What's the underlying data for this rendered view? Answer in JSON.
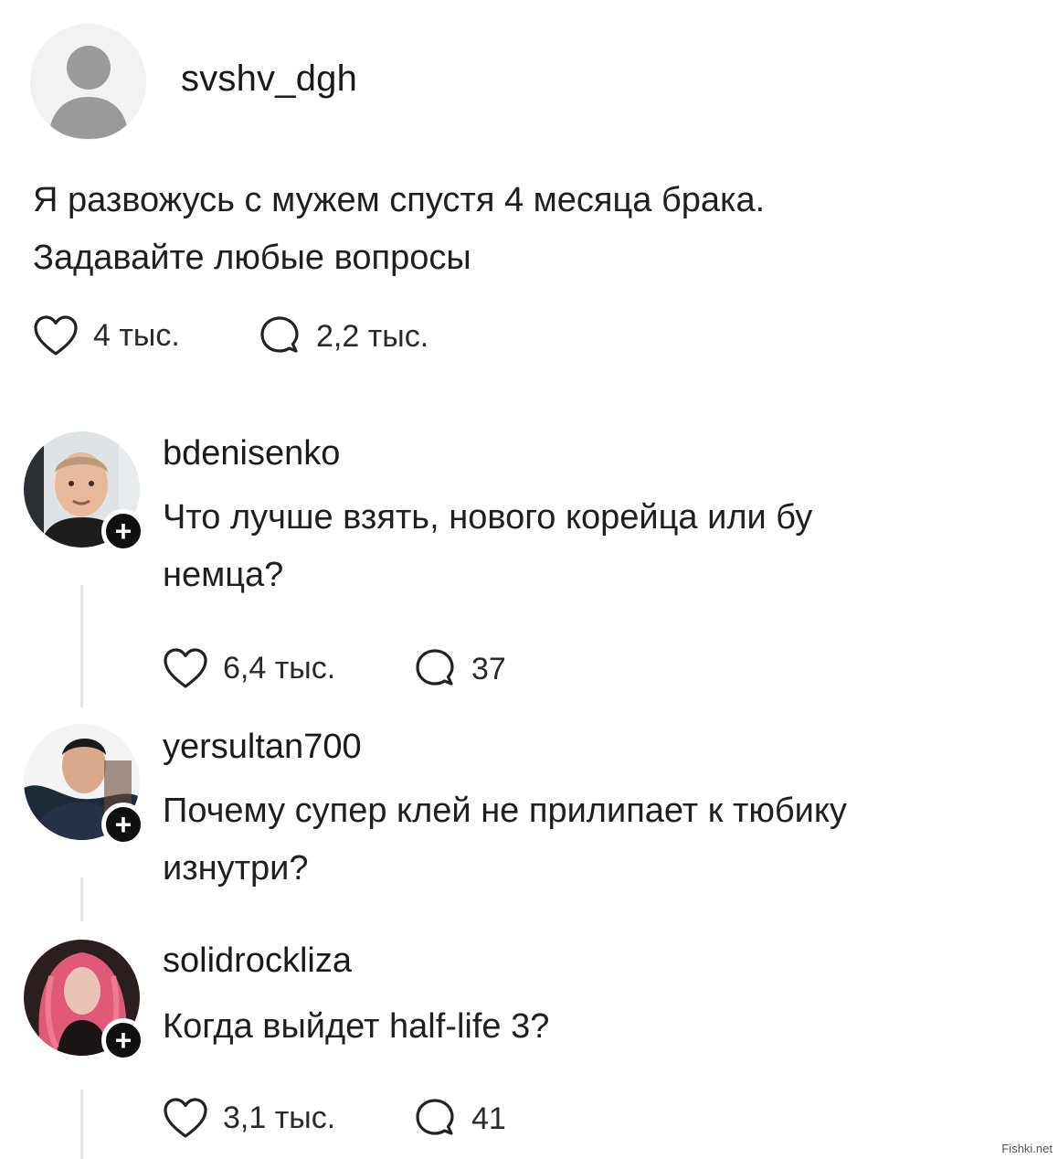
{
  "post": {
    "username": "svshv_dgh",
    "text_line1": "Я развожусь с мужем спустя 4 месяца брака.",
    "text_line2": "Задавайте любые вопросы",
    "likes": "4 тыс.",
    "comments": "2,2 тыс."
  },
  "comments": [
    {
      "username": "bdenisenko",
      "text_line1": "Что лучше взять, нового корейца или бу",
      "text_line2": "немца?",
      "likes": "6,4 тыс.",
      "replies": "37"
    },
    {
      "username": "yersultan700",
      "text_line1": "Почему супер клей не прилипает к тюбику",
      "text_line2": "изнутри?"
    },
    {
      "username": "solidrockliza",
      "text_line1": "Когда выйдет half-life 3?",
      "likes": "3,1 тыс.",
      "replies": "41"
    }
  ],
  "follow_symbol": "+",
  "watermark": "Fishki.net",
  "icons": [
    "default-avatar-icon",
    "heart-icon",
    "comment-bubble-icon",
    "follow-plus-icon"
  ]
}
